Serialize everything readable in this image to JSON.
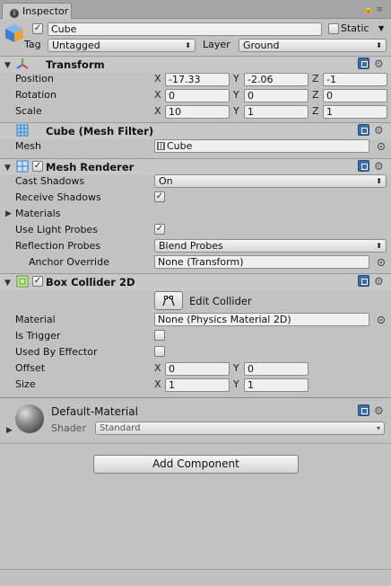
{
  "tab": {
    "title": "Inspector"
  },
  "object": {
    "name": "Cube",
    "active": true,
    "static_label": "Static",
    "static_checked": false,
    "tag_label": "Tag",
    "tag_value": "Untagged",
    "layer_label": "Layer",
    "layer_value": "Ground"
  },
  "transform": {
    "title": "Transform",
    "rows": [
      {
        "label": "Position",
        "x": "-17.33",
        "y": "-2.06",
        "z": "-1"
      },
      {
        "label": "Rotation",
        "x": "0",
        "y": "0",
        "z": "0"
      },
      {
        "label": "Scale",
        "x": "10",
        "y": "1",
        "z": "1"
      }
    ],
    "axes": {
      "x": "X",
      "y": "Y",
      "z": "Z"
    }
  },
  "mesh_filter": {
    "title": "Cube (Mesh Filter)",
    "mesh_label": "Mesh",
    "mesh_value": "Cube"
  },
  "mesh_renderer": {
    "title": "Mesh Renderer",
    "enabled": true,
    "cast_shadows_label": "Cast Shadows",
    "cast_shadows_value": "On",
    "receive_shadows_label": "Receive Shadows",
    "receive_shadows_checked": true,
    "materials_label": "Materials",
    "use_light_probes_label": "Use Light Probes",
    "use_light_probes_checked": true,
    "reflection_probes_label": "Reflection Probes",
    "reflection_probes_value": "Blend Probes",
    "anchor_override_label": "Anchor Override",
    "anchor_override_value": "None (Transform)"
  },
  "box_collider": {
    "title": "Box Collider 2D",
    "enabled": true,
    "edit_collider_label": "Edit Collider",
    "material_label": "Material",
    "material_value": "None (Physics Material 2D)",
    "is_trigger_label": "Is Trigger",
    "is_trigger_checked": false,
    "used_by_effector_label": "Used By Effector",
    "used_by_effector_checked": false,
    "offset_label": "Offset",
    "offset_x": "0",
    "offset_y": "0",
    "size_label": "Size",
    "size_x": "1",
    "size_y": "1"
  },
  "material": {
    "name": "Default-Material",
    "shader_label": "Shader",
    "shader_value": "Standard"
  },
  "add_component": {
    "label": "Add Component"
  },
  "icons": {
    "checkmark": "✓",
    "dropdown_arrow": "⬍",
    "foldout_open": "▼",
    "foldout_closed": "▶",
    "gear": "⚙"
  }
}
